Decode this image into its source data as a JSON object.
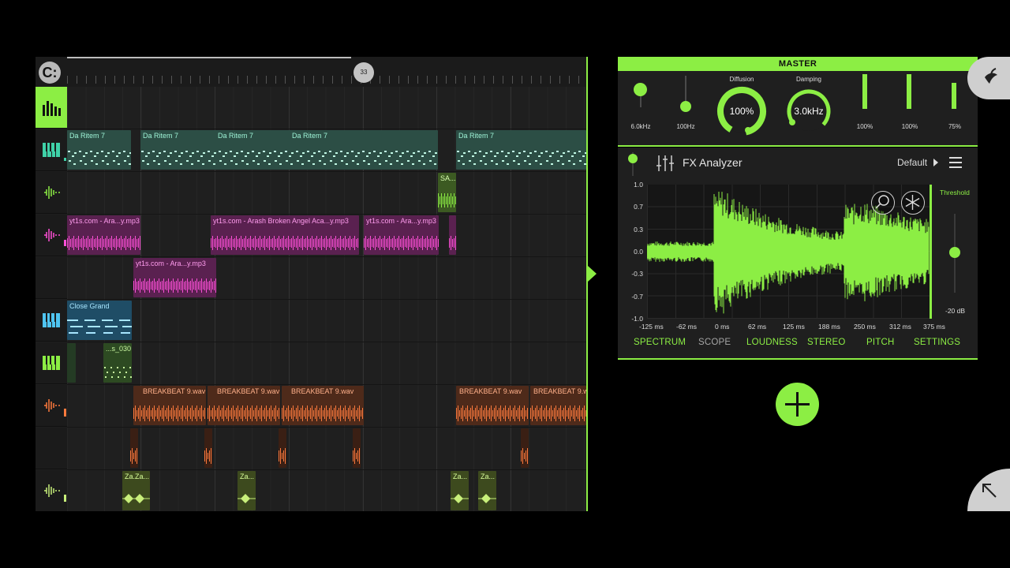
{
  "timeline": {
    "position_marker": "33"
  },
  "clips": {
    "da_ritem_1": "Da Ritem 7",
    "da_ritem_2": "Da Ritem 7",
    "da_ritem_3": "Da Ritem 7",
    "da_ritem_4": "Da Ritem 7",
    "da_ritem_5": "Da Ritem 7",
    "sa": "SA...",
    "yt1": "yt1s.com - Ara...y.mp3",
    "yt2": "yt1s.com - Arash  Broken Angel Aca...y.mp3",
    "yt3": "yt1s.com - Ara...y.mp3",
    "yt4": "yt1s.com - Ara...y.mp3",
    "close_grand": "Close Grand",
    "s030": "...s_030",
    "bb1": "BREAKBEAT 9.wav",
    "bb2": "BREAKBEAT 9.wav",
    "bb3": "BREAKBEAT 9.wav",
    "bb4": "BREAKBEAT 9.wav",
    "bb5": "BREAKBEAT 9.wav",
    "za1": "Za.Za...",
    "za2": "Za...",
    "za3": "Za...",
    "za4": "Za..."
  },
  "master": {
    "title": "MASTER",
    "slider1_value": "6.0kHz",
    "slider2_value": "100Hz",
    "diffusion_label": "Diffusion",
    "diffusion_value": "100%",
    "damping_label": "Damping",
    "damping_value": "3.0kHz",
    "bar1_value": "100%",
    "bar2_value": "100%",
    "bar3_value": "75%"
  },
  "fx": {
    "title": "FX Analyzer",
    "preset": "Default",
    "y_ticks": [
      "1.0",
      "0.7",
      "0.3",
      "0.0",
      "-0.3",
      "-0.7",
      "-1.0"
    ],
    "x_ticks": [
      "-125 ms",
      "-62 ms",
      "0 ms",
      "62 ms",
      "125 ms",
      "188 ms",
      "250 ms",
      "312 ms",
      "375 ms"
    ],
    "threshold_label": "Threshold",
    "threshold_db": "-20 dB",
    "tabs": [
      "SPECTRUM",
      "SCOPE",
      "LOUDNESS",
      "STEREO",
      "PITCH",
      "SETTINGS"
    ]
  },
  "colors": {
    "accent": "#8cee44",
    "pink": "#ff4fd8",
    "orange": "#ff7a3d",
    "teal": "#2d5b50",
    "blue": "#4fc4f0"
  }
}
